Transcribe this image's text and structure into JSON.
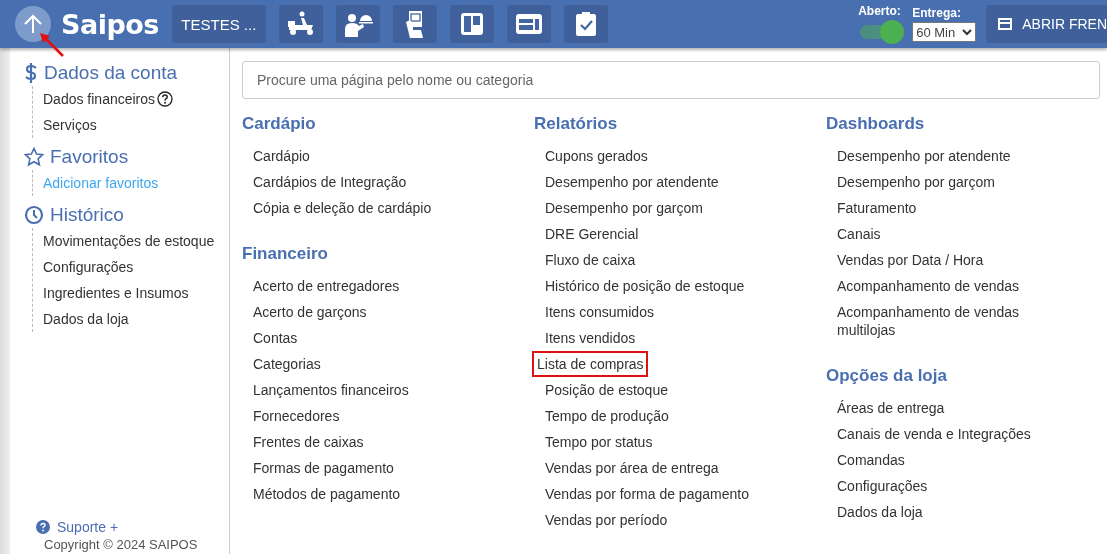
{
  "header": {
    "logo": "Saipos",
    "store_button": "TESTES ...",
    "icon_buttons": [
      {
        "kind": "delivery"
      },
      {
        "kind": "waiter"
      },
      {
        "kind": "ticket"
      },
      {
        "kind": "board"
      },
      {
        "kind": "panel"
      },
      {
        "kind": "checklist"
      }
    ],
    "open_label": "Aberto:",
    "open": true,
    "delivery_label": "Entrega:",
    "delivery_value": "60 Min",
    "front_button": "ABRIR FREN"
  },
  "sidebar": {
    "sections": [
      {
        "kind": "account",
        "title": "Dados da conta",
        "items": [
          {
            "label": "Dados financeiros",
            "help": true,
            "link": false
          },
          {
            "label": "Serviços",
            "help": false,
            "link": false
          }
        ]
      },
      {
        "kind": "favorites",
        "title": "Favoritos",
        "items": [
          {
            "label": "Adicionar favoritos",
            "help": false,
            "link": true
          }
        ]
      },
      {
        "kind": "history",
        "title": "Histórico",
        "items": [
          {
            "label": "Movimentações de estoque",
            "help": false,
            "link": false
          },
          {
            "label": "Configurações",
            "help": false,
            "link": false
          },
          {
            "label": "Ingredientes e Insumos",
            "help": false,
            "link": false
          },
          {
            "label": "Dados da loja",
            "help": false,
            "link": false
          }
        ]
      }
    ],
    "support": "Suporte +",
    "copyright": "Copyright © 2024 SAIPOS"
  },
  "search": {
    "placeholder": "Procure uma página pelo nome ou categoria"
  },
  "columns": [
    [
      {
        "title": "Cardápio",
        "items": [
          {
            "label": "Cardápio",
            "highlighted": false
          },
          {
            "label": "Cardápios de Integração",
            "highlighted": false
          },
          {
            "label": "Cópia e deleção de cardápio",
            "highlighted": false
          }
        ]
      },
      {
        "title": "Financeiro",
        "items": [
          {
            "label": "Acerto de entregadores",
            "highlighted": false
          },
          {
            "label": "Acerto de garçons",
            "highlighted": false
          },
          {
            "label": "Contas",
            "highlighted": false
          },
          {
            "label": "Categorias",
            "highlighted": false
          },
          {
            "label": "Lançamentos financeiros",
            "highlighted": false
          },
          {
            "label": "Fornecedores",
            "highlighted": false
          },
          {
            "label": "Frentes de caixas",
            "highlighted": false
          },
          {
            "label": "Formas de pagamento",
            "highlighted": false
          },
          {
            "label": "Métodos de pagamento",
            "highlighted": false
          }
        ]
      }
    ],
    [
      {
        "title": "Relatórios",
        "items": [
          {
            "label": "Cupons gerados",
            "highlighted": false
          },
          {
            "label": "Desempenho por atendente",
            "highlighted": false
          },
          {
            "label": "Desempenho por garçom",
            "highlighted": false
          },
          {
            "label": "DRE Gerencial",
            "highlighted": false
          },
          {
            "label": "Fluxo de caixa",
            "highlighted": false
          },
          {
            "label": "Histórico de posição de estoque",
            "highlighted": false
          },
          {
            "label": "Itens consumidos",
            "highlighted": false
          },
          {
            "label": "Itens vendidos",
            "highlighted": false
          },
          {
            "label": "Lista de compras",
            "highlighted": true
          },
          {
            "label": "Posição de estoque",
            "highlighted": false
          },
          {
            "label": "Tempo de produção",
            "highlighted": false
          },
          {
            "label": "Tempo por status",
            "highlighted": false
          },
          {
            "label": "Vendas por área de entrega",
            "highlighted": false
          },
          {
            "label": "Vendas por forma de pagamento",
            "highlighted": false
          },
          {
            "label": "Vendas por período",
            "highlighted": false
          }
        ]
      }
    ],
    [
      {
        "title": "Dashboards",
        "items": [
          {
            "label": "Desempenho por atendente",
            "highlighted": false
          },
          {
            "label": "Desempenho por garçom",
            "highlighted": false
          },
          {
            "label": "Faturamento",
            "highlighted": false
          },
          {
            "label": "Canais",
            "highlighted": false
          },
          {
            "label": "Vendas por Data / Hora",
            "highlighted": false
          },
          {
            "label": "Acompanhamento de vendas",
            "highlighted": false
          },
          {
            "label": "Acompanhamento de vendas multilojas",
            "highlighted": false
          }
        ]
      },
      {
        "title": "Opções da loja",
        "items": [
          {
            "label": "Áreas de entrega",
            "highlighted": false
          },
          {
            "label": "Canais de venda e Integrações",
            "highlighted": false
          },
          {
            "label": "Comandas",
            "highlighted": false
          },
          {
            "label": "Configurações",
            "highlighted": false
          },
          {
            "label": "Dados da loja",
            "highlighted": false
          }
        ]
      }
    ]
  ]
}
